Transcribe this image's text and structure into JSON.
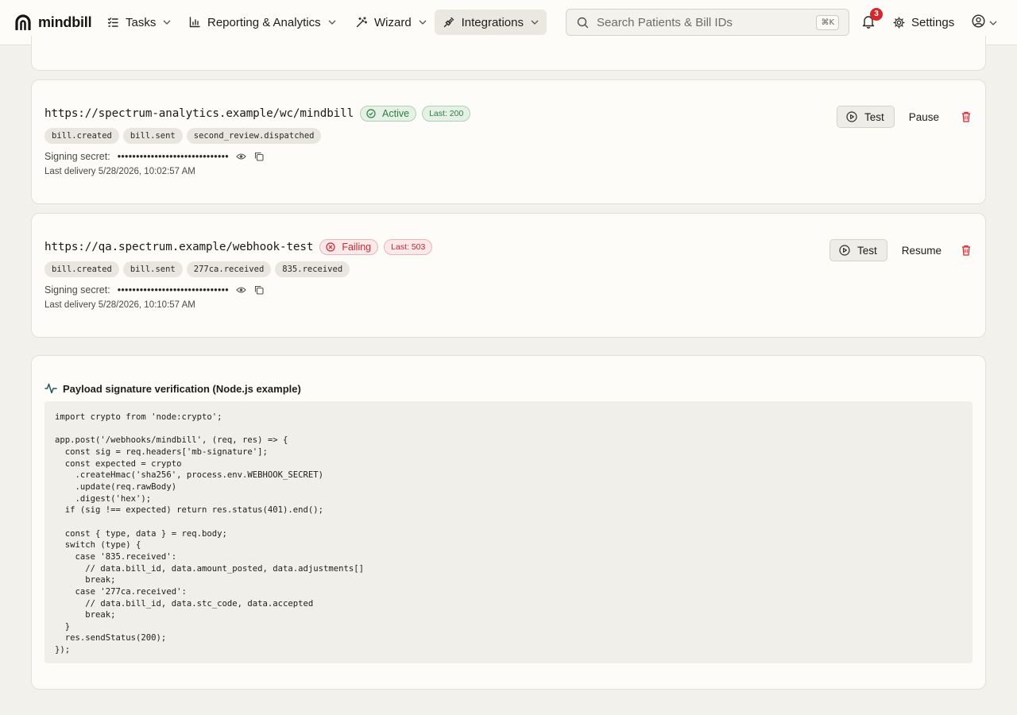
{
  "nav": {
    "brand": "mindbill",
    "items": [
      {
        "label": "Tasks",
        "icon": "tasks-list-icon"
      },
      {
        "label": "Reporting & Analytics",
        "icon": "bar-chart-icon"
      },
      {
        "label": "Wizard",
        "icon": "magic-wand-icon"
      },
      {
        "label": "Integrations",
        "icon": "plug-icon",
        "active": true
      }
    ],
    "search": {
      "placeholder": "Search Patients & Bill IDs",
      "shortcut": "⌘K"
    },
    "notifications": {
      "count": "3"
    },
    "settings_label": "Settings",
    "accent_color": "#d8262f"
  },
  "webhooks": [
    {
      "url": "https://spectrum-analytics.example/wc/mindbill",
      "status": "Active",
      "status_color": "#2f7d3f",
      "last": "Last: 200",
      "events": [
        "bill.created",
        "bill.sent",
        "second_review.dispatched"
      ],
      "secret_label": "Signing secret:",
      "secret_mask": "••••••••••••••••••••••••••••••",
      "last_delivery": "Last delivery 5/28/2026, 10:02:57 AM",
      "test_label": "Test",
      "toggle_label": "Pause"
    },
    {
      "url": "https://qa.spectrum.example/webhook-test",
      "status": "Failing",
      "status_color": "#c22a33",
      "last": "Last: 503",
      "events": [
        "bill.created",
        "bill.sent",
        "277ca.received",
        "835.received"
      ],
      "secret_label": "Signing secret:",
      "secret_mask": "••••••••••••••••••••••••••••••",
      "last_delivery": "Last delivery 5/28/2026, 10:10:57 AM",
      "test_label": "Test",
      "toggle_label": "Resume"
    }
  ],
  "code_example": {
    "title": "Payload signature verification (Node.js example)",
    "code": "import crypto from 'node:crypto';\n\napp.post('/webhooks/mindbill', (req, res) => {\n  const sig = req.headers['mb-signature'];\n  const expected = crypto\n    .createHmac('sha256', process.env.WEBHOOK_SECRET)\n    .update(req.rawBody)\n    .digest('hex');\n  if (sig !== expected) return res.status(401).end();\n\n  const { type, data } = req.body;\n  switch (type) {\n    case '835.received':\n      // data.bill_id, data.amount_posted, data.adjustments[]\n      break;\n    case '277ca.received':\n      // data.bill_id, data.stc_code, data.accepted\n      break;\n  }\n  res.sendStatus(200);\n});"
  }
}
